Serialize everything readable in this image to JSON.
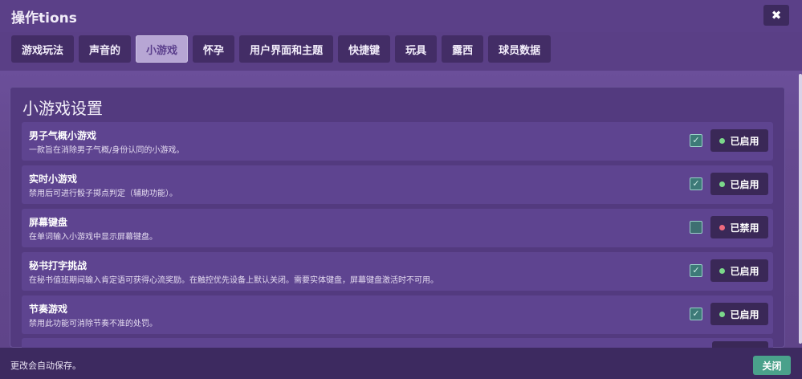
{
  "window": {
    "title": "操作tions",
    "close_glyph": "✖"
  },
  "tabs": [
    {
      "label": "游戏玩法"
    },
    {
      "label": "声音的"
    },
    {
      "label": "小游戏",
      "active": true
    },
    {
      "label": "怀孕"
    },
    {
      "label": "用户界面和主题"
    },
    {
      "label": "快捷键"
    },
    {
      "label": "玩具"
    },
    {
      "label": "露西"
    },
    {
      "label": "球员数据"
    }
  ],
  "panel": {
    "title": "小游戏设置",
    "rows": [
      {
        "name": "男子气概小游戏",
        "desc": "一款旨在消除男子气概/身份认同的小游戏。",
        "checked": true,
        "state": "已启用"
      },
      {
        "name": "实时小游戏",
        "desc": "禁用后可进行骰子掷点判定（辅助功能）。",
        "checked": true,
        "state": "已启用"
      },
      {
        "name": "屏幕键盘",
        "desc": "在单词输入小游戏中显示屏幕键盘。",
        "checked": false,
        "state": "已禁用"
      },
      {
        "name": "秘书打字挑战",
        "desc": "在秘书值班期间输入肯定语可获得心流奖励。在触控优先设备上默认关闭。需要实体键盘，屏幕键盘激活时不可用。",
        "checked": true,
        "state": "已启用"
      },
      {
        "name": "节奏游戏",
        "desc": "禁用此功能可消除节奏不准的处罚。",
        "checked": true,
        "state": "已启用"
      }
    ]
  },
  "footer": {
    "note": "更改会自动保存。",
    "close_label": "关闭"
  },
  "colors": {
    "accent": "#4aa18b",
    "enabled_dot": "#7bd88a",
    "disabled_dot": "#f06a7e",
    "active_tab": "#b7a6d4"
  }
}
